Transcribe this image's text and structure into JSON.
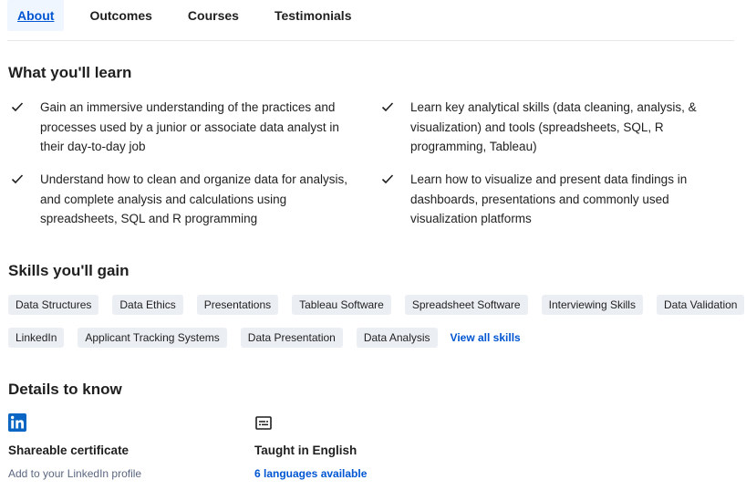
{
  "tabs": [
    {
      "label": "About",
      "active": true
    },
    {
      "label": "Outcomes",
      "active": false
    },
    {
      "label": "Courses",
      "active": false
    },
    {
      "label": "Testimonials",
      "active": false
    }
  ],
  "learn": {
    "heading": "What you'll learn",
    "items": [
      "Gain an immersive understanding of the practices and processes used by a junior or associate data analyst in their day-to-day job",
      "Learn key analytical skills (data cleaning, analysis, & visualization) and tools (spreadsheets, SQL, R programming, Tableau)",
      "Understand how to clean and organize data for analysis, and complete analysis and calculations using spreadsheets, SQL and R programming",
      "Learn how to visualize and present data findings in dashboards, presentations and commonly used visualization platforms"
    ]
  },
  "skills": {
    "heading": "Skills you'll gain",
    "row1": [
      "Data Structures",
      "Data Ethics",
      "Presentations",
      "Tableau Software",
      "Spreadsheet Software",
      "Interviewing Skills",
      "Data Validation"
    ],
    "row2": [
      "LinkedIn",
      "Applicant Tracking Systems",
      "Data Presentation",
      "Data Analysis"
    ],
    "view_all": "View all skills"
  },
  "details": {
    "heading": "Details to know",
    "certificate": {
      "icon": "linkedin-icon",
      "title": "Shareable certificate",
      "subtitle": "Add to your LinkedIn profile"
    },
    "language": {
      "icon": "captions-icon",
      "title": "Taught in English",
      "link": "6 languages available"
    }
  },
  "colors": {
    "accent": "#0056d2",
    "chip_bg": "#ebeef3",
    "linkedin": "#0a66c2"
  }
}
